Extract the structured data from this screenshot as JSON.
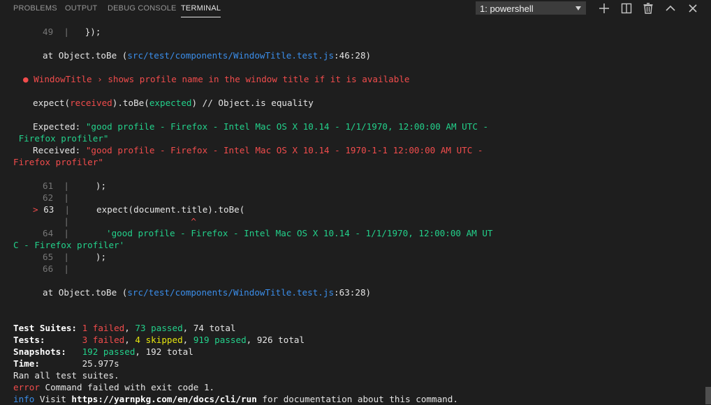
{
  "tabs": [
    {
      "label": "PROBLEMS"
    },
    {
      "label": "OUTPUT"
    },
    {
      "label": "DEBUG CONSOLE"
    },
    {
      "label": "TERMINAL"
    }
  ],
  "shell_select": {
    "value": "1: powershell"
  },
  "toolbar_icons": [
    "plus-icon",
    "split-icon",
    "trash-icon",
    "chevron-up-icon",
    "close-icon"
  ],
  "lines": {
    "l49_num": "49",
    "l49_bar": "|",
    "l49_code": "});",
    "at1_prefix": "at Object.toBe (",
    "at1_path": "src/test/components/",
    "at1_file": "WindowTitle.test.js",
    "at1_suffix": ":46:28)",
    "fail_title": "● WindowTitle › shows profile name in the window title if it is available",
    "expect_a": "expect(",
    "expect_received": "received",
    "expect_b": ").toBe(",
    "expect_expected": "expected",
    "expect_c": ") // Object.is equality",
    "expected_label": "Expected: ",
    "expected_val1": "\"good profile - Firefox - Intel Mac OS X 10.14 - 1/1/1970, 12:00:00 AM UTC -",
    "expected_val2": " Firefox profiler\"",
    "received_label": "Received: ",
    "received_val1": "\"good profile - Firefox - Intel Mac OS X 10.14 - 1970-1-1 12:00:00 AM UTC -",
    "received_val2": "Firefox profiler\"",
    "l61_num": "61",
    "l61_code": ");",
    "l62_num": "62",
    "l63_marker": ">",
    "l63_num": "63",
    "l63_code": "expect(document.title).toBe(",
    "caret": "^",
    "l64_num": "64",
    "l64_code": "'good profile - Firefox - Intel Mac OS X 10.14 - 1/1/1970, 12:00:00 AM UT",
    "l64_wrap": "C - Firefox profiler'",
    "l65_num": "65",
    "l65_code": ");",
    "l66_num": "66",
    "at2_prefix": "at Object.toBe (",
    "at2_path": "src/test/components/",
    "at2_file": "WindowTitle.test.js",
    "at2_suffix": ":63:28)",
    "suites_label": "Test Suites: ",
    "suites_failed": "1 failed",
    "suites_sep1": ", ",
    "suites_passed": "73 passed",
    "suites_rest": ", 74 total",
    "tests_label": "Tests:       ",
    "tests_failed": "3 failed",
    "tests_sep1": ", ",
    "tests_skipped": "4 skipped",
    "tests_sep2": ", ",
    "tests_passed": "919 passed",
    "tests_rest": ", 926 total",
    "snap_label": "Snapshots:   ",
    "snap_passed": "192 passed",
    "snap_rest": ", 192 total",
    "time_label": "Time:        ",
    "time_val": "25.977s",
    "ran_all": "Ran all test suites.",
    "error_word": "error",
    "error_msg": " Command failed with exit code 1.",
    "info_word": "info",
    "info_a": " Visit ",
    "info_url": "https://yarnpkg.com/en/docs/cli/run",
    "info_b": " for documentation about this command."
  },
  "colors": {
    "background": "#1e1e1e",
    "red": "#f14c4c",
    "green": "#23d18b",
    "yellow": "#e5e510",
    "blue": "#3b8eea"
  }
}
